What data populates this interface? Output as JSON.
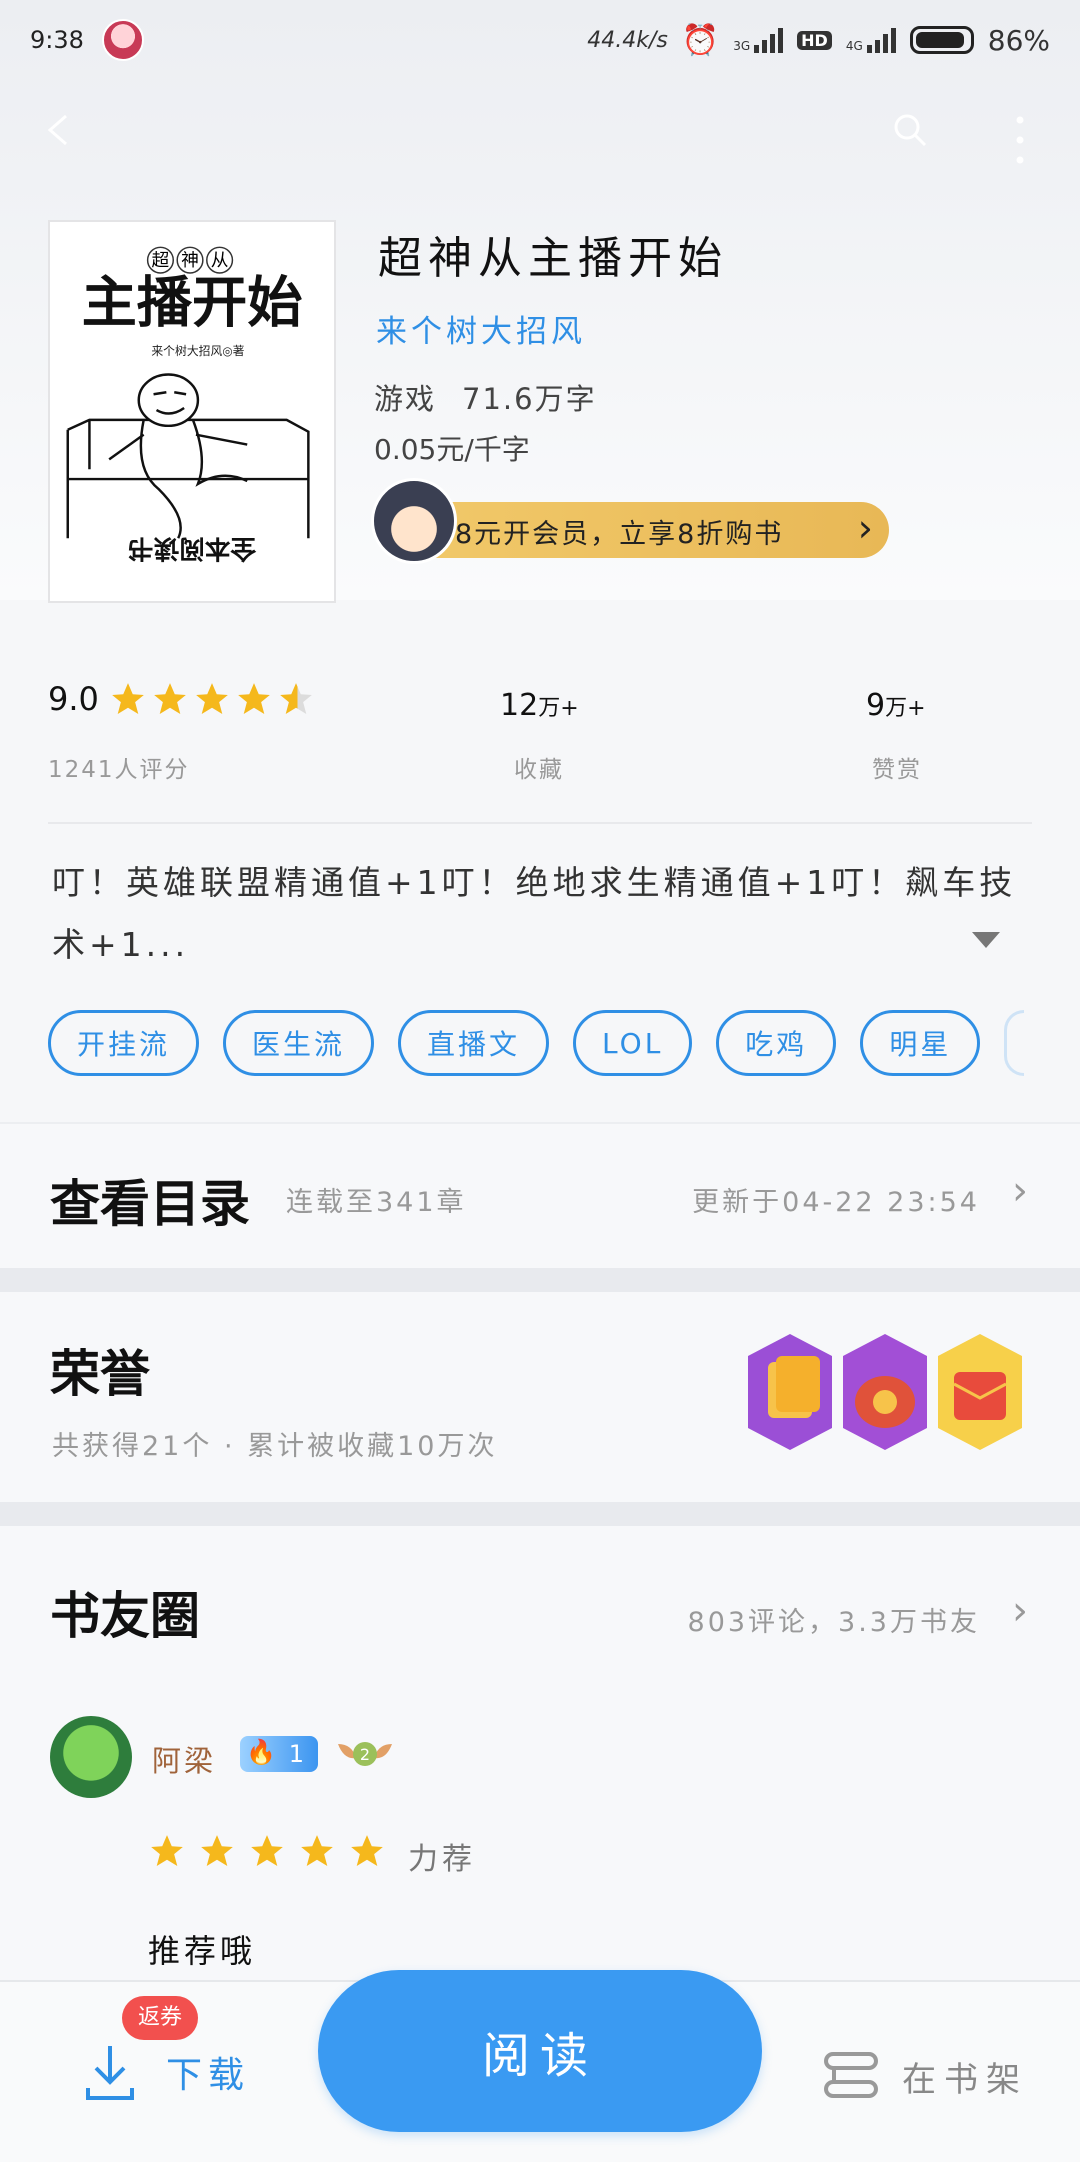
{
  "status_bar": {
    "time": "9:38",
    "speed": "44.4k/s",
    "net1": "3G",
    "hd": "HD",
    "net2": "4G",
    "battery": "86%"
  },
  "book": {
    "title": "超神从主播开始",
    "author": "来个树大招风",
    "genre": "游戏",
    "word_count": "71.6万字",
    "price": "0.05元/千字",
    "vip_promo": "8元开会员，立享8折购书",
    "cover": {
      "top_chars": [
        "超",
        "神",
        "从"
      ],
      "big_title": "主播开始",
      "cover_author": "来个树大招风◎著",
      "bottom_text": "全本阅读书"
    }
  },
  "stats": {
    "rating": "9.0",
    "rating_stars": 4.5,
    "rating_count": "1241人评分",
    "favorites_num": "12",
    "favorites_unit": "万+",
    "favorites_label": "收藏",
    "likes_num": "9",
    "likes_unit": "万+",
    "likes_label": "赞赏"
  },
  "description": "叮！英雄联盟精通值+1叮！绝地求生精通值+1叮！飙车技术+1...",
  "tags": [
    "开挂流",
    "医生流",
    "直播文",
    "LOL",
    "吃鸡",
    "明星"
  ],
  "catalog": {
    "title": "查看目录",
    "progress": "连载至341章",
    "updated": "更新于04-22 23:54"
  },
  "honor": {
    "title": "荣誉",
    "summary": "共获得21个 · 累计被收藏10万次"
  },
  "circle": {
    "title": "书友圈",
    "summary": "803评论，3.3万书友",
    "review": {
      "user": "阿梁",
      "fire_level": "1",
      "badge_level": "2",
      "stars": 5,
      "tag": "力荐",
      "text": "推荐哦"
    }
  },
  "bottom_bar": {
    "coupon": "返券",
    "download": "下载",
    "read": "阅读",
    "shelf": "在书架"
  },
  "colors": {
    "accent": "#2f8fe5",
    "read_button": "#3a9af2",
    "star": "#f5b81c",
    "coupon": "#f2504e"
  }
}
